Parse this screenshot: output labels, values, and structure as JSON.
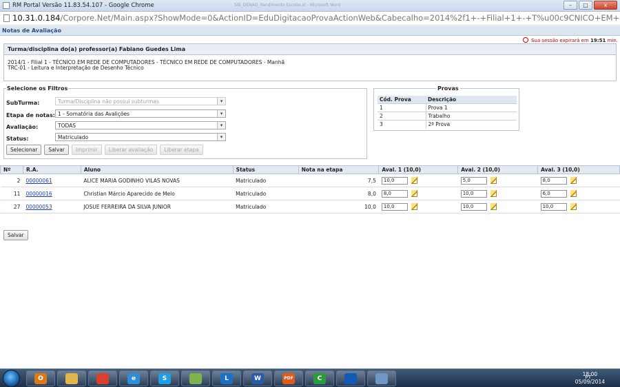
{
  "window": {
    "title": "RM Portal Versão 11.83.54.107 - Google Chrome",
    "ghost_title": "SIB_DENAO_Rendimento Escolar.xl - Microsoft Word",
    "url_host": "10.31.0.184",
    "url_path": "/Corpore.Net/Main.aspx?ShowMode=0&ActionID=EduDigitacaoProvaActionWeb&Cabecalho=2014%2f1+-+Filial+1+-+T%u00c9CNICO+EM+REDE+DE+COMPUTADO",
    "minimize": "–",
    "maximize": "□",
    "close": "x"
  },
  "page": {
    "title": "Notas de Avaliação",
    "session_prefix": "Sua sessão expirará em",
    "session_time": "19:51",
    "session_suffix": "min."
  },
  "turma": {
    "header": "Turma/disciplina do(a) professor(a) Fabiano Guedes Lima",
    "line1": "2014/1 - Filial 1 - TÉCNICO EM REDE DE COMPUTADORES - TÉCNICO EM REDE DE COMPUTADORES - Manhã",
    "line2": "TRC-01 - Leitura e Interpretação de Desenho Técnico"
  },
  "filters": {
    "legend": "Selecione os Filtros",
    "subturma_label": "SubTurma:",
    "subturma_value": "Turma/Disciplina não possui subturmas",
    "etapa_label": "Etapa de notas:",
    "etapa_value": "1 - Somatória das Avalições",
    "avaliacao_label": "Avaliação:",
    "avaliacao_value": "TODAS",
    "status_label": "Status:",
    "status_value": "Matriculado",
    "buttons": {
      "selecionar": "Selecionar",
      "salvar": "Salvar",
      "imprimir": "Imprimir",
      "liberar_avaliacao": "Liberar avaliação",
      "liberar_etapa": "Liberar etapa"
    }
  },
  "provas": {
    "legend": "Provas",
    "col_cod": "Cód. Prova",
    "col_desc": "Descrição",
    "rows": [
      {
        "cod": "1",
        "desc": "Prova 1"
      },
      {
        "cod": "2",
        "desc": "Trabalho"
      },
      {
        "cod": "3",
        "desc": "2ª Prova"
      }
    ]
  },
  "grid": {
    "headers": {
      "n": "Nº",
      "ra": "R.A.",
      "aluno": "Aluno",
      "status": "Status",
      "nota": "Nota na etapa",
      "aval1": "Aval. 1 (10,0)",
      "aval2": "Aval. 2 (10,0)",
      "aval3": "Aval. 3 (10,0)"
    },
    "rows": [
      {
        "n": "2",
        "ra": "00000061",
        "aluno": "ALICE MARIA GODINHO VILAS NOVAS",
        "status": "Matriculado",
        "nota": "7,5",
        "a1": "10,0",
        "a2": "5,0",
        "a3": "8,0"
      },
      {
        "n": "11",
        "ra": "00000016",
        "aluno": "Christian Márcio Aparecido de Melo",
        "status": "Matriculado",
        "nota": "8,0",
        "a1": "8,0",
        "a2": "10,0",
        "a3": "6,0"
      },
      {
        "n": "27",
        "ra": "00000053",
        "aluno": "JOSUE FERREIRA DA SILVA JUNIOR",
        "status": "Matriculado",
        "nota": "10,0",
        "a1": "10,0",
        "a2": "10,0",
        "a3": "10,0"
      }
    ]
  },
  "bottom": {
    "salvar": "Salvar"
  },
  "taskbar": {
    "apps": [
      {
        "name": "outlook-icon",
        "glyph": "O",
        "color": "#d87a1c"
      },
      {
        "name": "explorer-icon",
        "glyph": "",
        "color": "#e2b84a"
      },
      {
        "name": "chrome-icon",
        "glyph": "",
        "color": "#d9412f"
      },
      {
        "name": "ie-icon",
        "glyph": "e",
        "color": "#2c8fd8"
      },
      {
        "name": "skype-icon",
        "glyph": "S",
        "color": "#1ea0e8"
      },
      {
        "name": "folder-icon",
        "glyph": "",
        "color": "#7fb24a"
      },
      {
        "name": "lync-icon",
        "glyph": "L",
        "color": "#1b6fc6"
      },
      {
        "name": "word-icon",
        "glyph": "W",
        "color": "#2a5aa8"
      },
      {
        "name": "pdf-icon",
        "glyph": "PDF",
        "color": "#e05a1c"
      },
      {
        "name": "camtasia-icon",
        "glyph": "C",
        "color": "#2d9a3c"
      },
      {
        "name": "app-icon",
        "glyph": "",
        "color": "#1458b8"
      },
      {
        "name": "network-icon",
        "glyph": "",
        "color": "#6e97c8"
      }
    ],
    "lang": "PT",
    "time": "18:00",
    "date": "05/09/2014"
  }
}
